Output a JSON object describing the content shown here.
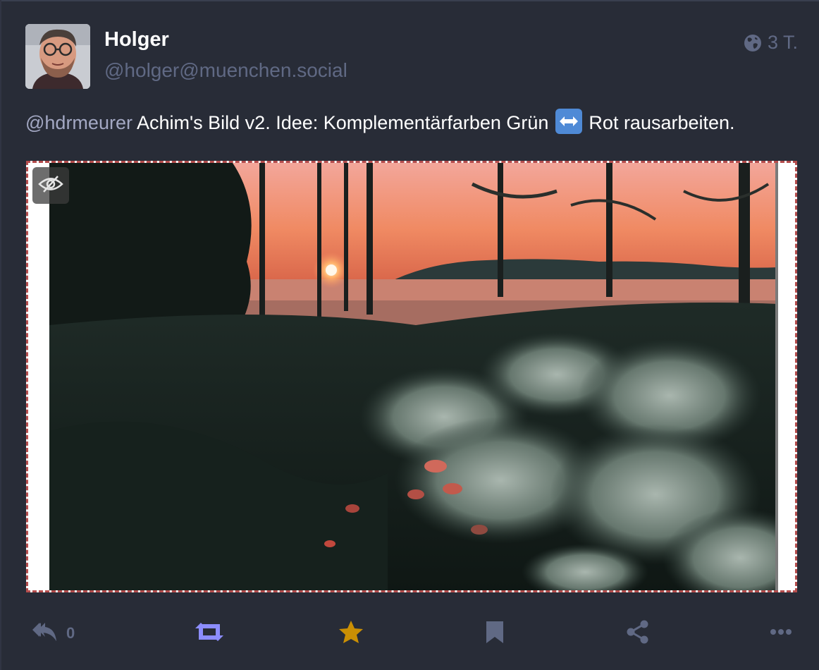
{
  "account": {
    "display_name": "Holger",
    "handle": "@holger@muenchen.social"
  },
  "meta": {
    "visibility_icon": "globe-icon",
    "relative_time": "3 T."
  },
  "status": {
    "mention": "@hdrmeurer",
    "text_before_emoji": " Achim's Bild v2. Idee: Komplementärfarben Grün ",
    "emoji": "left-right-arrow-emoji",
    "text_after_emoji": " Rot rausarbeiten."
  },
  "media": {
    "hide_icon": "eye-slash-icon"
  },
  "actions": {
    "reply_count": "0",
    "reply_icon": "reply-all-icon",
    "boost_icon": "retweet-icon",
    "favourite_icon": "star-icon",
    "bookmark_icon": "bookmark-icon",
    "share_icon": "share-icon",
    "more_icon": "ellipsis-icon"
  },
  "colors": {
    "background": "#282c37",
    "muted": "#606984",
    "boosted": "#8c8dff",
    "favourited": "#ca8f04",
    "sensitive_border": "#b54d4d"
  }
}
